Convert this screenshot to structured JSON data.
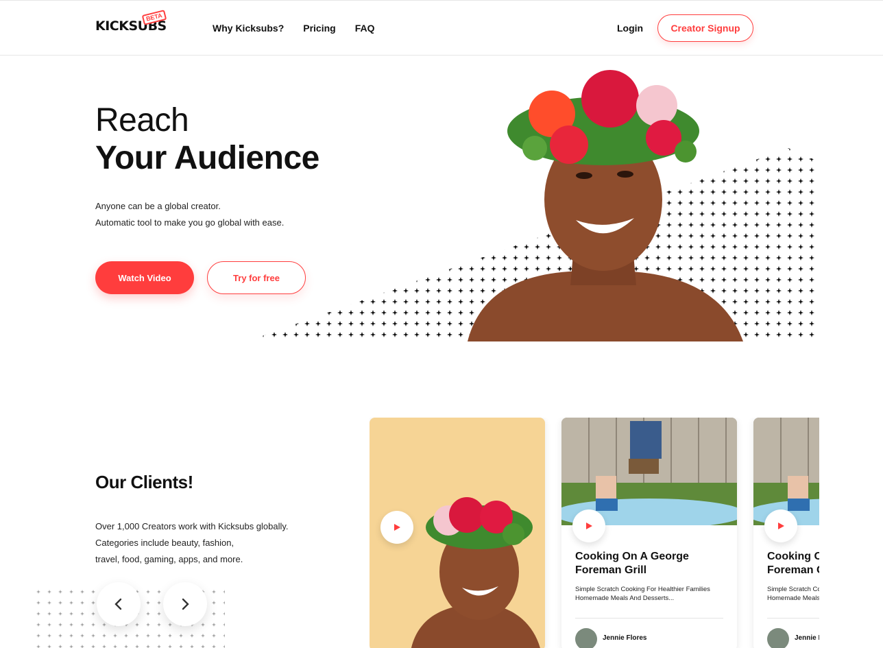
{
  "brand": {
    "logo_text": "KICKSUBS",
    "badge": "BETA"
  },
  "nav": {
    "items": [
      "Why Kicksubs?",
      "Pricing",
      "FAQ"
    ],
    "login": "Login",
    "signup": "Creator Signup"
  },
  "colors": {
    "accent": "#ff3d3d",
    "text": "#111111",
    "card_feature_bg": "#f6d495"
  },
  "hero": {
    "line1": "Reach",
    "line2": "Your Audience",
    "sub1": "Anyone can be a global creator.",
    "sub2": "Automatic tool to make you go global with ease.",
    "watch_button": "Watch Video",
    "try_button": "Try for free"
  },
  "clients": {
    "title": "Our Clients!",
    "desc": [
      "Over 1,000 Creators work with Kicksubs globally.",
      "Categories include beauty, fashion,",
      "travel, food, gaming, apps, and more."
    ],
    "prev_icon": "chevron-left-icon",
    "next_icon": "chevron-right-icon"
  },
  "cards": [
    {
      "type": "feature",
      "play_icon": "play-icon"
    },
    {
      "title": "Cooking On A George Foreman Grill",
      "desc": "Simple Scratch Cooking For Healthier Families Homemade Meals And Desserts...",
      "author": "Jennie Flores",
      "play_icon": "play-icon"
    },
    {
      "title": "Cooking On A George Foreman Grill",
      "desc": "Simple Scratch Cooking For Healthier Families Homemade Meals And Desserts...",
      "author": "Jennie Flores",
      "play_icon": "play-icon"
    }
  ]
}
